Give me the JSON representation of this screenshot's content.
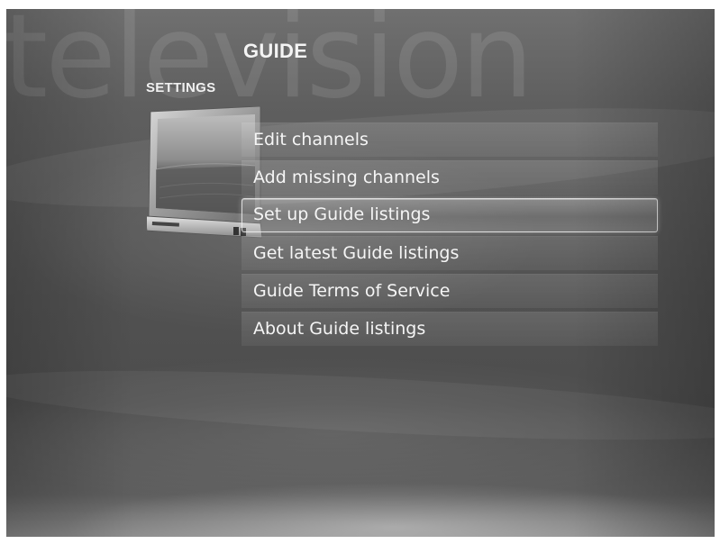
{
  "app": {
    "watermark": "television",
    "title": "GUIDE",
    "subtitle": "SETTINGS"
  },
  "menu": {
    "items": [
      {
        "label": "Edit channels",
        "focused": false
      },
      {
        "label": "Add missing channels",
        "focused": false
      },
      {
        "label": "Set up Guide listings",
        "focused": true
      },
      {
        "label": "Get latest Guide listings",
        "focused": false
      },
      {
        "label": "Guide Terms of Service",
        "focused": false
      },
      {
        "label": "About Guide listings",
        "focused": false
      }
    ]
  },
  "icons": {
    "tv": "television-icon"
  }
}
